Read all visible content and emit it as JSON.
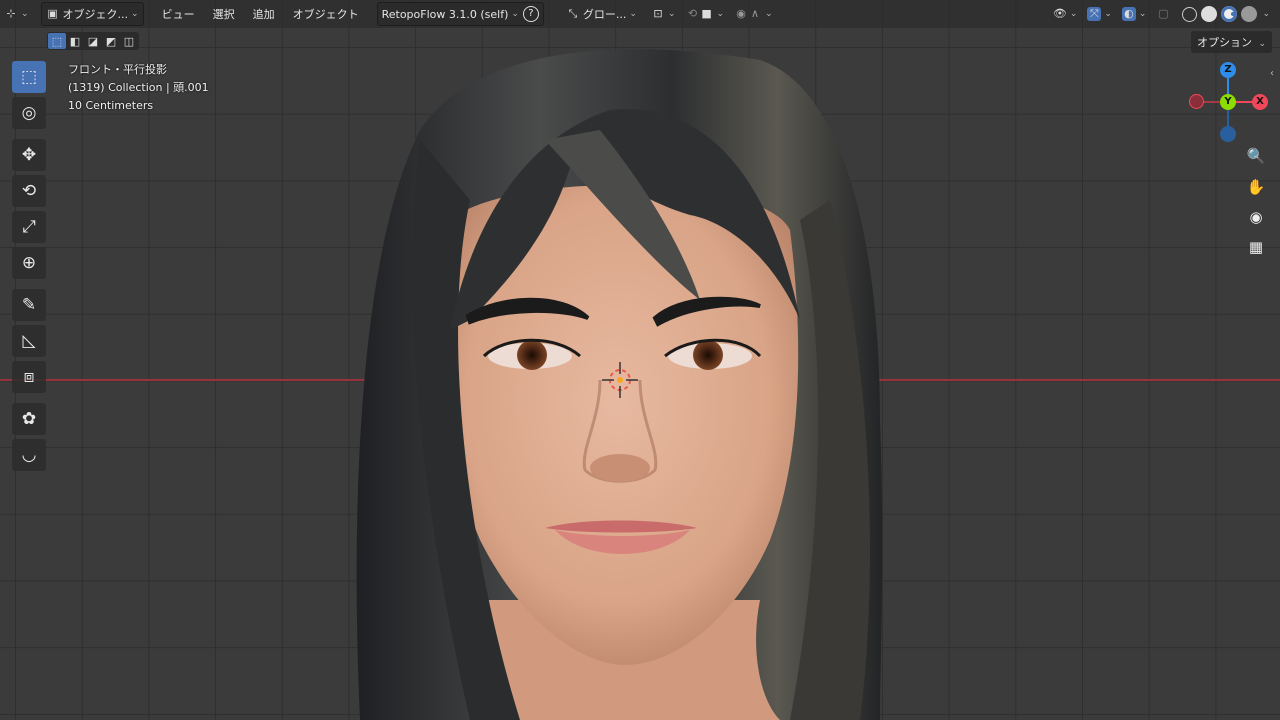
{
  "header": {
    "editor_type_icon": "coordinate-axes-icon",
    "mode_label": "オブジェク...",
    "menus": [
      "ビュー",
      "選択",
      "追加",
      "オブジェクト"
    ],
    "addon_label": "RetopoFlow 3.1.0 (self)",
    "help_icon": "?",
    "orientation_label": "グロー...",
    "pivot_icon": "pivot-icon",
    "snap_icon": "snap-icon",
    "proportional_icon": "proportional-icon"
  },
  "selection_modes": [
    "new",
    "extend",
    "subtract",
    "invert",
    "intersect"
  ],
  "options_label": "オプション",
  "overlay_info": {
    "view_name": "フロント・平行投影",
    "collection": "(1319) Collection | 頭.001",
    "scale": "10 Centimeters"
  },
  "tools": [
    {
      "name": "select-box",
      "glyph": "⬚",
      "active": true
    },
    {
      "name": "cursor",
      "glyph": "◎",
      "active": false
    },
    {
      "name": "move",
      "glyph": "✥",
      "active": false
    },
    {
      "name": "rotate",
      "glyph": "⟲",
      "active": false
    },
    {
      "name": "scale",
      "glyph": "⤢",
      "active": false
    },
    {
      "name": "transform",
      "glyph": "⊕",
      "active": false
    },
    {
      "name": "annotate",
      "glyph": "✎",
      "active": false
    },
    {
      "name": "measure",
      "glyph": "📐",
      "active": false
    },
    {
      "name": "add-cube",
      "glyph": "⧈",
      "active": false
    },
    {
      "name": "retopoflow",
      "glyph": "✿",
      "active": false
    },
    {
      "name": "curve",
      "glyph": "◡",
      "active": false
    }
  ],
  "gizmo": {
    "z": "Z",
    "y": "Y",
    "x": "X"
  },
  "colors": {
    "accent": "#4772b3",
    "x_axis": "#f0485a",
    "y_axis": "#8bdc00",
    "z_axis": "#2e8ceb"
  }
}
